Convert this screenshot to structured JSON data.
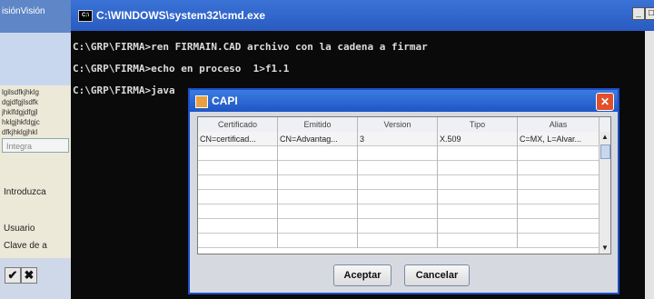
{
  "bg_app": {
    "title": "isiónVisión",
    "lines": [
      "lgilsdfkjhklg",
      "dgjdfgjlsdfk",
      "jhklfdgjdfgjl",
      "hklgjhkfdgjc",
      "dfkjhklgjhkl"
    ],
    "integrate_label": "Integra",
    "intro_label": "Introduzca",
    "usuario_label": "Usuario",
    "clave_label": "Clave de a",
    "ok_glyph": "✔",
    "cancel_glyph": "✖"
  },
  "cmd": {
    "title": "C:\\WINDOWS\\system32\\cmd.exe",
    "lines": [
      "C:\\GRP\\FIRMA>ren FIRMAIN.CAD archivo con la cadena a firmar",
      "C:\\GRP\\FIRMA>echo en proceso  1>f1.1",
      "C:\\GRP\\FIRMA>java"
    ],
    "minimize_glyph": "_",
    "maximize_glyph": "□",
    "close_glyph": "x"
  },
  "dialog": {
    "title": "CAPI",
    "close_glyph": "✕",
    "columns": [
      "Certificado",
      "Emitido",
      "Version",
      "Tipo",
      "Alias"
    ],
    "rows": [
      [
        "CN=certificad...",
        "CN=Advantag...",
        "3",
        "X.509",
        "C=MX, L=Alvar..."
      ]
    ],
    "empty_row_count": 7,
    "accept_label": "Aceptar",
    "cancel_label": "Cancelar"
  }
}
